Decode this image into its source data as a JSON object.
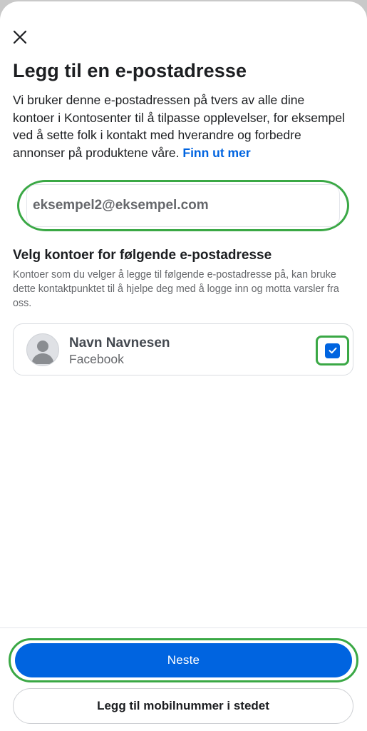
{
  "header": {
    "close_icon": "close-icon",
    "title": "Legg til en e-postadresse"
  },
  "intro": {
    "text": "Vi bruker denne e-postadressen på tvers av alle dine kontoer i Kontosenter til å tilpasse opplevelser, for eksempel ved å sette folk i kontakt med hverandre og forbedre annonser på produktene våre.",
    "link_label": "Finn ut mer"
  },
  "email": {
    "value": "eksempel2@eksempel.com"
  },
  "accounts_section": {
    "title": "Velg kontoer for følgende e-postadresse",
    "subtitle": "Kontoer som du velger å legge til følgende e-postadresse på, kan bruke dette kontaktpunktet til å hjelpe deg med å logge inn og motta varsler fra oss.",
    "accounts": [
      {
        "name": "Navn Navnesen",
        "platform": "Facebook",
        "avatar_icon": "default-avatar-icon",
        "checked": true
      }
    ]
  },
  "footer": {
    "primary_label": "Neste",
    "secondary_label": "Legg til mobilnummer i stedet"
  },
  "colors": {
    "accent": "#0064e0",
    "highlight": "#3aa845"
  }
}
